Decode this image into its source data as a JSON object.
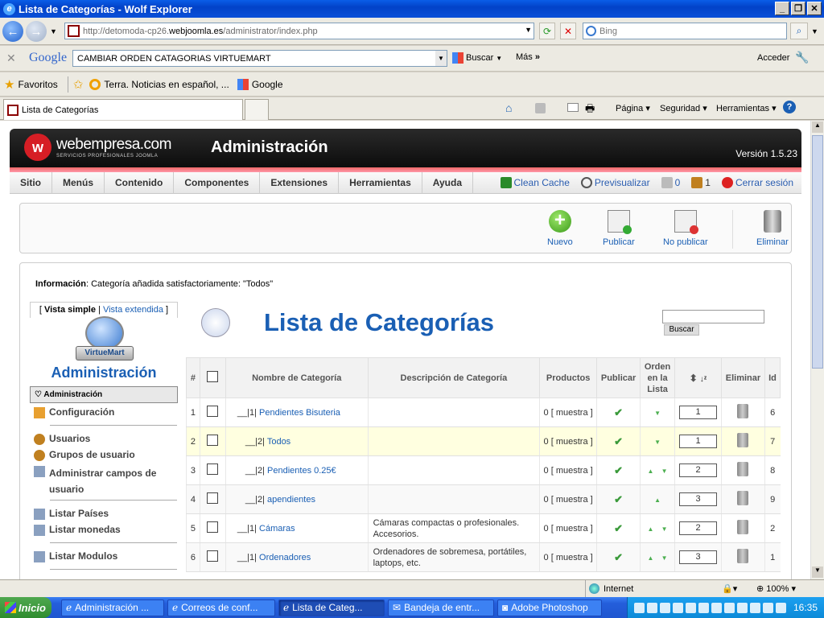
{
  "window": {
    "title": "Lista de Categorías - Wolf Explorer"
  },
  "address": {
    "url_prefix": "http://detomoda-cp26.",
    "url_host": "webjoomla.es",
    "url_suffix": "/administrator/index.php",
    "bing_placeholder": "Bing"
  },
  "google": {
    "logo": "Google",
    "query": "CAMBIAR ORDEN CATAGORIAS VIRTUEMART",
    "buscar": "Buscar",
    "mas": "Más",
    "acceder": "Acceder"
  },
  "favorites": {
    "label": "Favoritos",
    "items": [
      "Terra. Noticias en español, ...",
      "Google"
    ]
  },
  "tab": {
    "title": "Lista de Categorías"
  },
  "ie_commands": {
    "pagina": "Página",
    "seguridad": "Seguridad",
    "herramientas": "Herramientas"
  },
  "joomla": {
    "brand": "webempresa.com",
    "tagline": "SERVICIOS PROFESIONALES JOOMLA",
    "header_title": "Administración",
    "version": "Versión 1.5.23",
    "menu": [
      "Sitio",
      "Menús",
      "Contenido",
      "Componentes",
      "Extensiones",
      "Herramientas",
      "Ayuda"
    ],
    "clean_cache": "Clean Cache",
    "previsualizar": "Previsualizar",
    "msg_count": "0",
    "users_count": "1",
    "cerrar": "Cerrar sesión"
  },
  "toolbar": {
    "nuevo": "Nuevo",
    "publicar": "Publicar",
    "no_publicar": "No publicar",
    "eliminar": "Eliminar"
  },
  "info": {
    "label": "Información",
    "text": ": Categoría añadida satisfactoriamente: \"Todos\""
  },
  "sidebar": {
    "vista_simple": "Vista simple",
    "vista_extendida": "Vista extendida",
    "vm_logo": "VirtueMart",
    "title": "Administración",
    "section": "Administración",
    "items": [
      "Configuración",
      "Usuarios",
      "Grupos de usuario",
      "Administrar campos de usuario",
      "Listar Países",
      "Listar monedas",
      "Listar Modulos"
    ]
  },
  "list": {
    "title": "Lista de Categorías",
    "search_button": "Buscar",
    "headers": {
      "num": "#",
      "name": "Nombre de Categoría",
      "desc": "Descripción de Categoría",
      "products": "Productos",
      "publish": "Publicar",
      "order": "Orden en la Lista",
      "delete": "Eliminar",
      "id": "Id"
    },
    "rows": [
      {
        "num": "1",
        "prefix": "__|1|",
        "name": "Pendientes Bisuteria",
        "desc": "",
        "products": "0",
        "muestra": "[ muestra ]",
        "order": "1",
        "id": "6"
      },
      {
        "num": "2",
        "prefix": "__|2|",
        "name": "Todos",
        "desc": "",
        "products": "0",
        "muestra": "[ muestra ]",
        "order": "1",
        "id": "7"
      },
      {
        "num": "3",
        "prefix": "__|2|",
        "name": "Pendientes 0.25€",
        "desc": "",
        "products": "0",
        "muestra": "[ muestra ]",
        "order": "2",
        "id": "8"
      },
      {
        "num": "4",
        "prefix": "__|2|",
        "name": "apendientes",
        "desc": "",
        "products": "0",
        "muestra": "[ muestra ]",
        "order": "3",
        "id": "9"
      },
      {
        "num": "5",
        "prefix": "__|1|",
        "name": "Cámaras",
        "desc": "Cámaras compactas o profesionales. Accesorios.",
        "products": "0",
        "muestra": "[ muestra ]",
        "order": "2",
        "id": "2"
      },
      {
        "num": "6",
        "prefix": "__|1|",
        "name": "Ordenadores",
        "desc": "Ordenadores de sobremesa, portátiles, laptops, etc.",
        "products": "0",
        "muestra": "[ muestra ]",
        "order": "3",
        "id": "1"
      }
    ]
  },
  "status": {
    "zone": "Internet",
    "zoom": "100%"
  },
  "taskbar": {
    "start": "Inicio",
    "tasks": [
      "Administración ...",
      "Correos de conf...",
      "Lista de Categ...",
      "Bandeja de entr...",
      "Adobe Photoshop"
    ],
    "clock": "16:35"
  }
}
